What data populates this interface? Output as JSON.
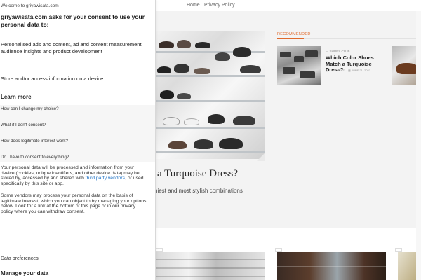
{
  "site": {
    "nav": {
      "home": "Home",
      "privacy": "Privacy Policy"
    },
    "hero": {
      "title": "a Turquoise Dress?",
      "subtitle": "chiest and most stylish combinations"
    },
    "recommended": {
      "label": "RECOMMENDED",
      "category": "SHOES CLUB",
      "title": "Which Color Shoes Match a Turquoise Dress?",
      "read_time": "1 MIN READ",
      "date": "JUNE 21, 2023"
    }
  },
  "consent": {
    "welcome": "Welcome to griyawisata.com",
    "heading": "griyawisata.com asks for your consent to use your personal data to:",
    "purposes": [
      "Personalised ads and content, ad and content measurement, audience insights and product development",
      "Store and/or access information on a device"
    ],
    "learn_more": "Learn more",
    "faq": [
      "How can I change my choice?",
      "What if I don't consent?",
      "How does legitimate interest work?",
      "Do I have to consent to everything?"
    ],
    "body1_pre": "Your personal data will be processed and information from your device (cookies, unique identifiers, and other device data) may be stored by, accessed by and shared with ",
    "body1_link": "third party vendors",
    "body1_post": ", or used specifically by this site or app.",
    "body2": "Some vendors may process your personal data on the basis of legitimate interest, which you can object to by managing your options below. Look for a link at the bottom of this page or in our privacy policy where you can withdraw consent.",
    "data_preferences": "Data preferences",
    "manage": "Manage your data"
  },
  "colors": {
    "accent": "#e06a2c",
    "link": "#1a6fc4"
  }
}
